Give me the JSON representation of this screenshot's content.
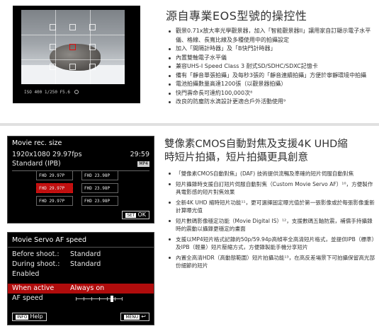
{
  "top": {
    "viewfinder": {
      "info_text": "ISO 400  1/250  F5.6",
      "icons": [
        "af-point-grid",
        "level-icon"
      ]
    },
    "title": "源自專業EOS型號的操控性",
    "bullets": [
      "觀景0.71x放大率光學觀景器，加入「智能觀景器II」讓用家自訂顯示電子水平儀、格線、長寬比線及多種使用中的拍攝設定",
      "加入「間隔計時器」及「B快門計時器」",
      "內置雙軸電子水平儀",
      "兼容UHS-I Speed Class 3 耐式SD/SDHC/SDXC記憶卡",
      "備有「靜音單張拍攝」及每秒3張的「靜音連續拍攝」方便於寧靜環境中拍攝",
      "電池拍攝數量高達1200張（以觀景器拍攝）",
      "快門壽命長可達約100,000次⁸",
      "改良的防塵防水滴設計更適合戶外活動使用⁹"
    ]
  },
  "movie_rec": {
    "title": "Movie rec. size",
    "resolution": "1920x1080 29.97fps",
    "time": "29:59",
    "quality": "Standard (IPB)",
    "format": "MP4",
    "size_options": [
      [
        "FHD 29.97P",
        "FHD 23.98P"
      ],
      [
        "FHD 29.97P",
        "FHD 23.98P"
      ],
      [
        "FHD 29.97P",
        "FHD 23.98P"
      ]
    ],
    "set_label": "SET",
    "ok_label": "OK"
  },
  "servo": {
    "title": "Movie Servo AF speed",
    "rows": [
      {
        "label": "Before shoot.:",
        "value": "Standard"
      },
      {
        "label": "During shoot.:",
        "value": "Standard"
      },
      {
        "label": "Enabled",
        "value": ""
      },
      {
        "label": "When active",
        "value": "Always on"
      },
      {
        "label": "AF speed",
        "value": ""
      }
    ],
    "af_speed_level": 0.78,
    "info_key": "INFO",
    "info_label": "Help",
    "menu_key": "MENU",
    "menu_label": "↩"
  },
  "bottom": {
    "title_line1": "雙像素CMOS自動對焦及支援4K UHD縮",
    "title_line2": "時短片拍攝，短片拍攝更具創意",
    "bullets": [
      "「雙像素CMOS自動對焦」(DAF) 技術提供流暢及準確的短片伺服自動對焦",
      "短片攝錄時支援自訂短片伺服自動對焦（Custom Movie Servo AF）¹⁰，方便製作具電影感的短片對焦效果",
      "全新4K UHD 縮時短片功能¹¹，更可選擇固定曝光值於第一張影像或於每張影像重新計算曝光值",
      "短片數碼影像穩定功能（Movie Digital IS）¹²，支援數碼五軸防震，補償手持攝錄時的震動以攝錄更穩定的畫面",
      "支援以MP4短片格式記錄的50p/59.94p高幀率全高清短片格式，並提供IPB（標準）及IPB（輕量）短片壓縮方式，方便錄製能手機分享短片",
      "內置全高清HDR（高動態範圍）短片拍攝功能¹³，在高反差場景下可拍攝保留高光部份細節的短片"
    ]
  },
  "colors": {
    "accent_red": "#b00c0c",
    "screen_bg": "#000000"
  }
}
